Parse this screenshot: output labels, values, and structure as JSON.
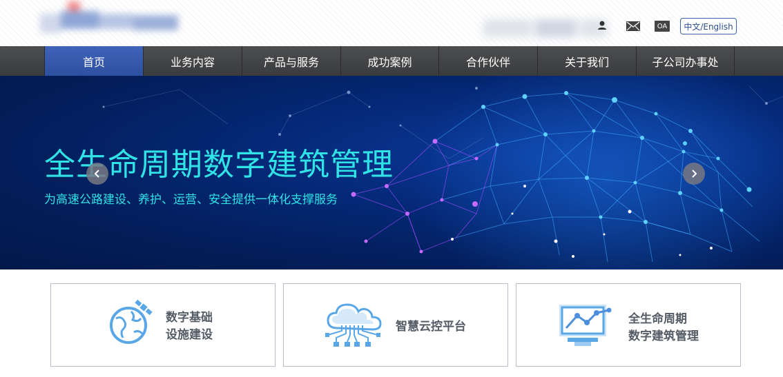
{
  "header": {
    "language_toggle": "中文/English",
    "oa_label": "OA"
  },
  "nav": {
    "items": [
      {
        "label": "首页",
        "active": true
      },
      {
        "label": "业务内容"
      },
      {
        "label": "产品与服务"
      },
      {
        "label": "成功案例"
      },
      {
        "label": "合作伙伴"
      },
      {
        "label": "关于我们"
      },
      {
        "label": "子公司办事处"
      }
    ]
  },
  "banner": {
    "title": "全生命周期数字建筑管理",
    "subtitle": "为高速公路建设、养护、运营、安全提供一体化支撑服务"
  },
  "cards": [
    {
      "line1": "数字基础",
      "line2": "设施建设",
      "icon": "globe-satellite-icon"
    },
    {
      "line1": "智慧云控平台",
      "line2": "",
      "icon": "cloud-circuit-icon"
    },
    {
      "line1": "全生命周期",
      "line2": "数字建筑管理",
      "icon": "monitor-chart-icon"
    }
  ],
  "colors": {
    "nav_active": "#3a5fb4",
    "banner_text": "#2fe3e6",
    "card_icon": "#5aa7e8"
  }
}
